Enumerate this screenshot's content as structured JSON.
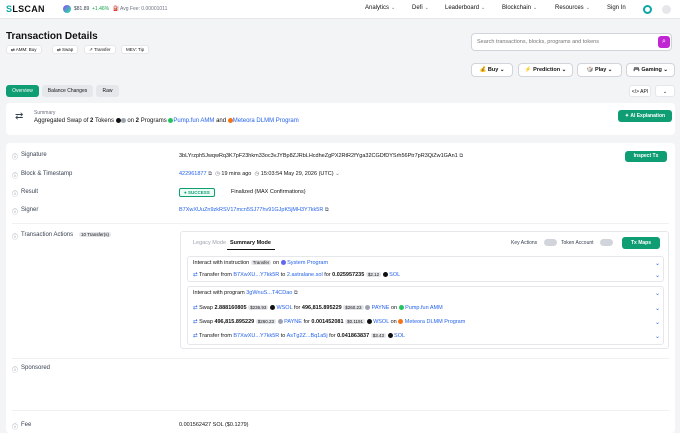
{
  "nav": {
    "logo_a": "S",
    "logo_b": "LSCAN",
    "sol_price": "$81.89",
    "sol_change": "+1.46%",
    "avg_fee": "Avg Fee: 0.00001011",
    "items": [
      "Analytics",
      "Defi",
      "Leaderboard",
      "Blockchain",
      "Resources"
    ],
    "signin": "Sign In"
  },
  "page": {
    "title": "Transaction Details",
    "tags": [
      "AMM: Buy",
      "Swap",
      "Transfer",
      "MEV: Tip"
    ]
  },
  "search": {
    "placeholder": "Search transactions, blocks, programs and tokens"
  },
  "actions": [
    "Buy",
    "Prediction",
    "Play",
    "Gaming"
  ],
  "tabs": [
    "Overview",
    "Balance Changes",
    "Raw"
  ],
  "api": "API",
  "summary": {
    "label": "Summary",
    "text_a": "Aggregated Swap of",
    "count_tokens": "2",
    "text_b": "Tokens",
    "text_c": "on",
    "count_programs": "2",
    "text_d": "Programs",
    "prog1": "Pump.fun AMM",
    "and": "and",
    "prog2": "Meteora DLMM Program",
    "ai": "AI Explanation"
  },
  "details": {
    "signature_label": "Signature",
    "signature": "3bLYrzph5JwqwRq3K7pF23hkm33oc3vJYBp8ZJRbLHcdheZgPX2RtR2fYga32CGDfDYSrh56Ptr7pR3QiZw1GAn1",
    "inspect": "Inspect Tx",
    "block_label": "Block & Timestamp",
    "block": "422961877",
    "ago": "19 mins ago",
    "timestamp": "15:03:54 May 29, 2026 (UTC)",
    "result_label": "Result",
    "success": "SUCCESS",
    "finalized": "Finalized (MAX Confirmations)",
    "signer_label": "Signer",
    "signer": "B7XwXUuZn9zkRSV17mcn5SJ77hv91GJpK5jMH3Y7kk5R"
  },
  "ta": {
    "label": "Transaction Actions",
    "count": "10 Transfer(s)",
    "legacy": "Legacy Mode",
    "summary_mode": "Summary Mode",
    "key_actions": "Key Actions",
    "token_account": "Token Account",
    "tx_maps": "Tx Maps",
    "g1_title": "Interact with instruction",
    "g1_badge": "Transfer",
    "g1_on": "on",
    "g1_prog": "System Program",
    "r1": {
      "a": "Transfer from",
      "from": "B7XwXU...Y7kk5R",
      "to_t": "to",
      "to": "2.astralane.sol",
      "for": "for",
      "amt": "0.025957235",
      "usd": "$2.12",
      "tok": "SOL"
    },
    "g2_title": "Interact with program",
    "g2_prog": "3gWnuS...T4CDao",
    "r2": {
      "a": "Swap",
      "amt1": "2.888160805",
      "usd1": "$236.93",
      "tok1": "WSOL",
      "for": "for",
      "amt2": "496,815.895229",
      "usd2": "$260.23",
      "tok2": "PAYNE",
      "on": "on",
      "prog": "Pump.fun AMM"
    },
    "r3": {
      "a": "Swap",
      "amt1": "496,815.895229",
      "usd1": "$260.23",
      "tok1": "PAYNE",
      "for": "for",
      "amt2": "0.001452081",
      "usd2": "$0.1191",
      "tok2": "WSOL",
      "on": "on",
      "prog": "Meteora DLMM Program"
    },
    "r4": {
      "a": "Transfer from",
      "from": "B7XwXU...Y7kk5R",
      "to_t": "to",
      "to": "AsTg2Z...Bq1a5j",
      "for": "for",
      "amt": "0.041863837",
      "usd": "$3.43",
      "tok": "SOL"
    }
  },
  "sponsored": "Sponsored",
  "fee": {
    "label": "Fee",
    "value": "0.001562427 SOL ($0.1279)"
  },
  "colors": {
    "accent": "#0f9d73",
    "link": "#2563eb",
    "purple": "#c026d3",
    "up": "#16a34a"
  }
}
